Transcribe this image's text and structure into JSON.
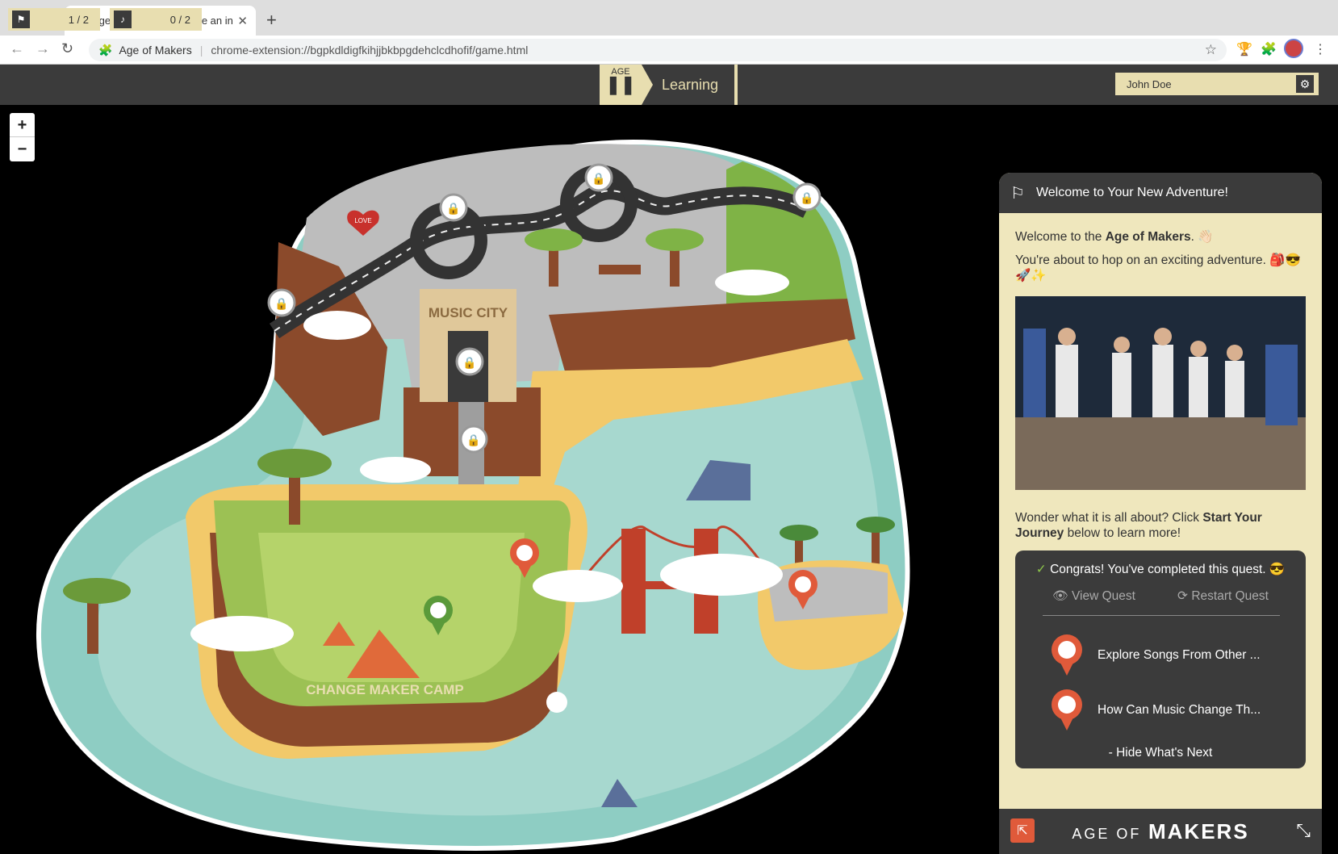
{
  "browser": {
    "tab_title": "Age of Makers - Become an in",
    "site_name": "Age of Makers",
    "url": "chrome-extension://bgpkdldigfkihjjbkbpgdehclcdhofif/game.html"
  },
  "game_bar": {
    "quests_count": "1 / 2",
    "music_count": "0 / 2",
    "age_label": "AGE",
    "age_name": "Learning",
    "user_name": "John Doe"
  },
  "map": {
    "zoom_in": "+",
    "zoom_out": "−",
    "sign_music_city": "MUSIC CITY",
    "sign_camp": "CHANGE MAKER CAMP",
    "love_sign": "LOVE"
  },
  "panel": {
    "title": "Welcome to Your New Adventure!",
    "intro_prefix": "Welcome to the ",
    "intro_bold": "Age of Makers",
    "intro_suffix": ". 👋🏻",
    "line2": "You're about to hop on an exciting adventure. 🎒😎🚀✨",
    "wonder_prefix": "Wonder what it is all about? Click ",
    "wonder_bold": "Start Your Journey",
    "wonder_suffix": " below to learn more!",
    "congrats": "Congrats! You've completed this quest. 😎",
    "view_quest": "View Quest",
    "restart_quest": "Restart Quest",
    "next_items": [
      "Explore Songs From Other ...",
      "How Can Music Change Th..."
    ],
    "hide_next": "- Hide What's Next",
    "logo_thin": "AGE OF",
    "logo_bold": "MAKERS"
  },
  "colors": {
    "bar": "#3b3b3b",
    "cream": "#efe7bd",
    "pin_orange": "#e05a3a",
    "water": "#8ecdc3"
  }
}
